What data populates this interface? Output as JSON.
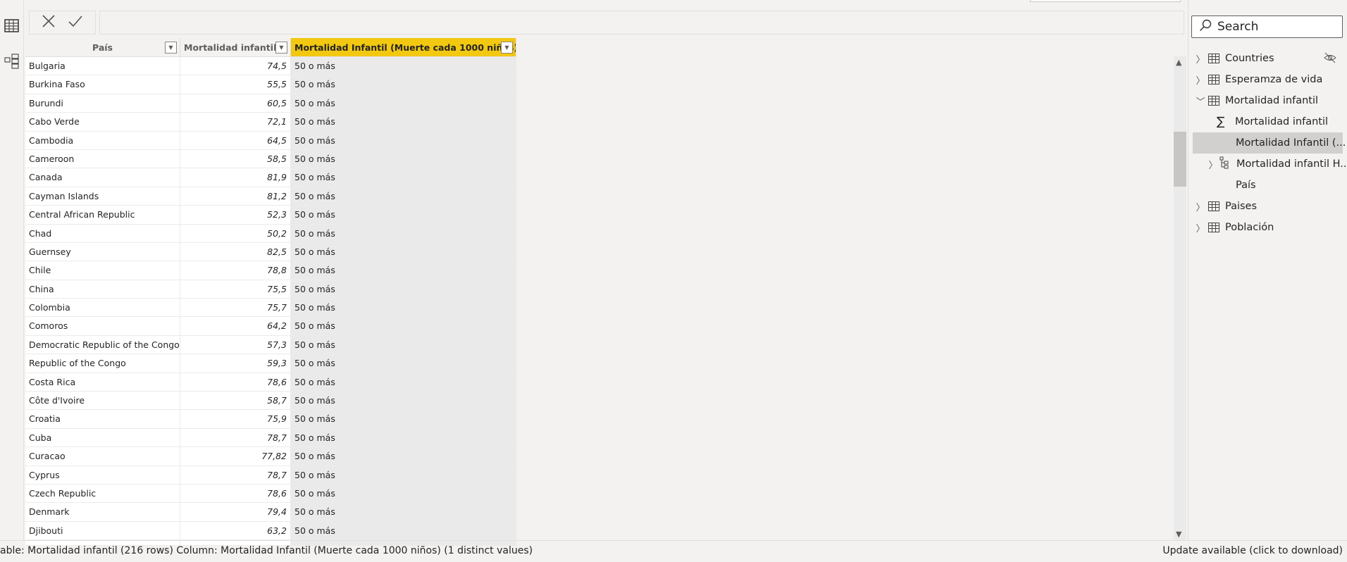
{
  "formula_bar": {
    "cancel_icon": "x-icon",
    "commit_icon": "check-icon",
    "value": ""
  },
  "columns": [
    "País",
    "Mortalidad infantil",
    "Mortalidad Infantil (Muerte cada 1000 niños)"
  ],
  "selected_column_color": "#f2c811",
  "rows": [
    [
      "Bulgaria",
      "74,5",
      "50 o más"
    ],
    [
      "Burkina Faso",
      "55,5",
      "50 o más"
    ],
    [
      "Burundi",
      "60,5",
      "50 o más"
    ],
    [
      "Cabo Verde",
      "72,1",
      "50 o más"
    ],
    [
      "Cambodia",
      "64,5",
      "50 o más"
    ],
    [
      "Cameroon",
      "58,5",
      "50 o más"
    ],
    [
      "Canada",
      "81,9",
      "50 o más"
    ],
    [
      "Cayman Islands",
      "81,2",
      "50 o más"
    ],
    [
      "Central African Republic",
      "52,3",
      "50 o más"
    ],
    [
      "Chad",
      "50,2",
      "50 o más"
    ],
    [
      "Guernsey",
      "82,5",
      "50 o más"
    ],
    [
      "Chile",
      "78,8",
      "50 o más"
    ],
    [
      "China",
      "75,5",
      "50 o más"
    ],
    [
      "Colombia",
      "75,7",
      "50 o más"
    ],
    [
      "Comoros",
      "64,2",
      "50 o más"
    ],
    [
      "Democratic Republic of the Congo",
      "57,3",
      "50 o más"
    ],
    [
      "Republic of the Congo",
      "59,3",
      "50 o más"
    ],
    [
      "Costa Rica",
      "78,6",
      "50 o más"
    ],
    [
      "Côte d'Ivoire",
      "58,7",
      "50 o más"
    ],
    [
      "Croatia",
      "75,9",
      "50 o más"
    ],
    [
      "Cuba",
      "78,7",
      "50 o más"
    ],
    [
      "Curacao",
      "77,82",
      "50 o más"
    ],
    [
      "Cyprus",
      "78,7",
      "50 o más"
    ],
    [
      "Czech Republic",
      "78,6",
      "50 o más"
    ],
    [
      "Denmark",
      "79,4",
      "50 o más"
    ],
    [
      "Djibouti",
      "63,2",
      "50 o más"
    ]
  ],
  "fields": {
    "search_placeholder": "Search",
    "items": [
      {
        "label": "Countries",
        "type": "table",
        "expanded": false,
        "hidden": true
      },
      {
        "label": "Esperamza de vida",
        "type": "table",
        "expanded": false
      },
      {
        "label": "Mortalidad infantil",
        "type": "table",
        "expanded": true
      },
      {
        "label": "Mortalidad infantil",
        "type": "measure-column"
      },
      {
        "label": "Mortalidad Infantil (...",
        "type": "column",
        "selected": true
      },
      {
        "label": "Mortalidad infantil H...",
        "type": "hierarchy"
      },
      {
        "label": "País",
        "type": "column"
      },
      {
        "label": "Paises",
        "type": "table",
        "expanded": false
      },
      {
        "label": "Población",
        "type": "table",
        "expanded": false
      }
    ]
  },
  "status": {
    "left": "able: Mortalidad infantil (216 rows) Column: Mortalidad Infantil (Muerte cada 1000 niños) (1 distinct values)",
    "right": "Update available (click to download)"
  }
}
